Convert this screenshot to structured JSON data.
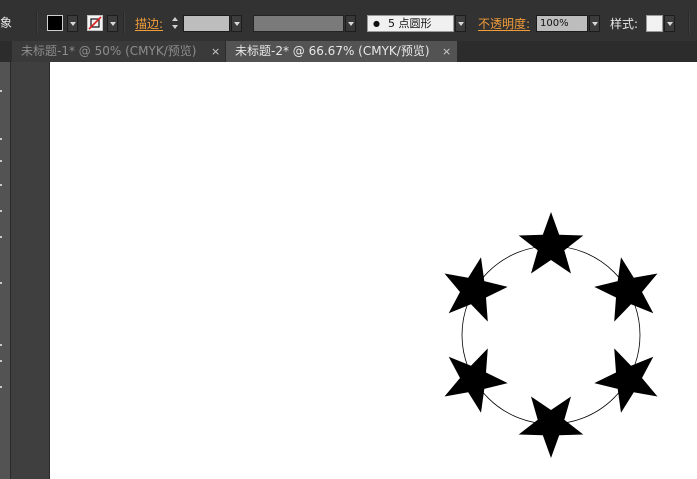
{
  "control_bar": {
    "object_label": "象",
    "fill": {
      "color": "#000000"
    },
    "stroke": {
      "color": "none"
    },
    "stroke_label": "描边:",
    "stroke_weight_value": "",
    "variable_width_value": "",
    "brush": {
      "value": "5 点圆形",
      "dot_symbol": "●"
    },
    "opacity_label": "不透明度:",
    "opacity_value": "100%",
    "style_label": "样式:"
  },
  "tabs": [
    {
      "label": "未标题-1* @ 50% (CMYK/预览)",
      "close": "×",
      "active": false
    },
    {
      "label": "未标题-2* @ 66.67% (CMYK/预览)",
      "close": "×",
      "active": true
    }
  ],
  "artwork": {
    "shape_count": 6,
    "shape": "star-icon",
    "shape_fill": "#000000",
    "path_stroke": "#000000",
    "path_shape": "circle"
  },
  "colors": {
    "ui_dark": "#323232",
    "accent_orange": "#f29c38",
    "artboard": "#ffffff"
  }
}
